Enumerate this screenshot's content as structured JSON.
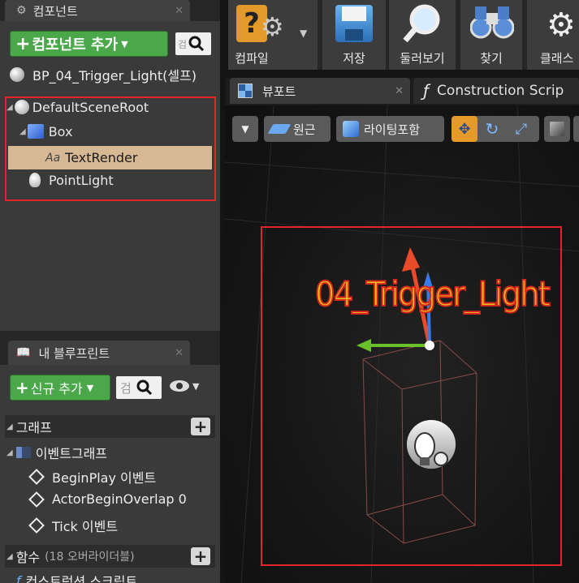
{
  "components_panel": {
    "tab_label": "컴포넌트",
    "add_button_label": "컴포넌트 추가",
    "search_placeholder": "검",
    "self_item": "BP_04_Trigger_Light(셀프)",
    "tree": [
      {
        "label": "DefaultSceneRoot",
        "icon": "scene-root-icon"
      },
      {
        "label": "Box",
        "icon": "box-icon"
      },
      {
        "label": "TextRender",
        "icon": "text-render-icon",
        "selected": true
      },
      {
        "label": "PointLight",
        "icon": "point-light-icon"
      }
    ]
  },
  "blueprint_panel": {
    "tab_label": "내 블루프린트",
    "new_button_label": "신규 추가",
    "search_placeholder": "검",
    "graph_section": "그래프",
    "event_graph": "이벤트그래프",
    "events": [
      "BeginPlay 이벤트",
      "ActorBeginOverlap 0",
      "Tick 이벤트"
    ],
    "functions_section": "함수",
    "functions_override": "(18 오버라이더블)",
    "construction_script": "컨스트럭션 스크립트"
  },
  "toolbar": {
    "items": [
      {
        "label": "컴파일",
        "icon": "compile-icon"
      },
      {
        "label": "저장",
        "icon": "save-icon"
      },
      {
        "label": "둘러보기",
        "icon": "browse-icon"
      },
      {
        "label": "찾기",
        "icon": "find-icon"
      },
      {
        "label": "클래스",
        "icon": "class-settings-icon"
      }
    ]
  },
  "editor_tabs": {
    "viewport": "뷰포트",
    "construction": "Construction Scrip"
  },
  "viewport_toolbar": {
    "perspective_label": "원근",
    "lighting_label": "라이팅포함"
  },
  "viewport": {
    "text_render_value": "04_Trigger_Light"
  },
  "colors": {
    "highlight_box": "#e0252c",
    "selected_row": "#d6b894",
    "green_button": "#4aa84a",
    "text_render_fill": "#e8c21a",
    "text_render_outline": "#d8261f"
  }
}
